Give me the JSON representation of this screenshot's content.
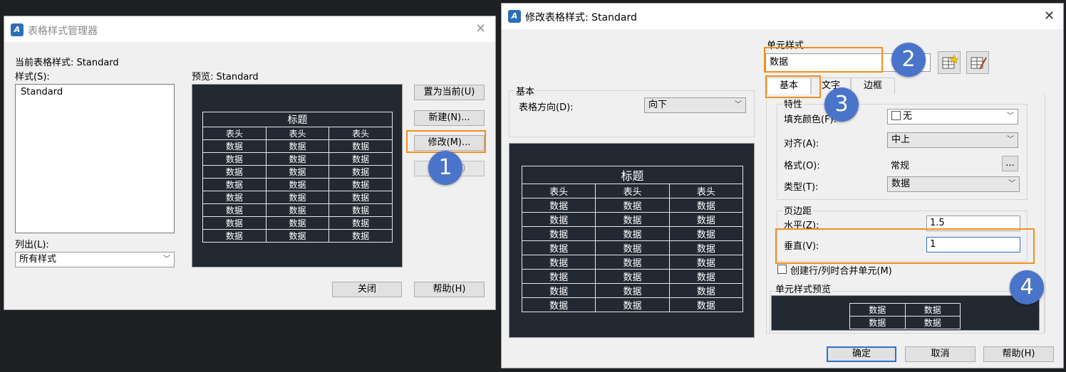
{
  "manager": {
    "title": "表格样式管理器",
    "current_style_label": "当前表格样式: Standard",
    "styles_label": "样式(S):",
    "styles": [
      "Standard"
    ],
    "list_label": "列出(L):",
    "list_value": "所有样式",
    "preview_label": "预览: Standard",
    "buttons": {
      "set_current": "置为当前(U)",
      "new": "新建(N)...",
      "modify": "修改(M)...",
      "delete": "删除(D)",
      "close": "关闭",
      "help": "帮助(H)"
    }
  },
  "modify": {
    "title": "修改表格样式: Standard",
    "basic_group": "基本",
    "direction_label": "表格方向(D):",
    "direction_value": "向下",
    "cell_style_label": "单元样式",
    "cell_style_value": "数据",
    "tabs": [
      "基本",
      "文字",
      "边框"
    ],
    "properties_label": "特性",
    "fill_color_label": "填充颜色(F):",
    "fill_color_value": "无",
    "align_label": "对齐(A):",
    "align_value": "中上",
    "format_label": "格式(O):",
    "format_value": "常规",
    "format_btn": "...",
    "type_label": "类型(T):",
    "type_value": "数据",
    "margins_label": "页边距",
    "horizontal_label": "水平(Z):",
    "horizontal_value": "1.5",
    "vertical_label": "垂直(V):",
    "vertical_value": "1",
    "merge_label": "创建行/列时合并单元(M)",
    "cell_preview_label": "单元样式预览",
    "buttons": {
      "ok": "确定",
      "cancel": "取消",
      "help": "帮助(H)"
    }
  },
  "preview_table": {
    "title": "标题",
    "header": "表头",
    "data": "数据"
  },
  "markers": [
    "1",
    "2",
    "3",
    "4"
  ],
  "colors": {
    "highlight": "#f0901e",
    "marker": "#4a74c9",
    "preview_bg": "#222933"
  }
}
